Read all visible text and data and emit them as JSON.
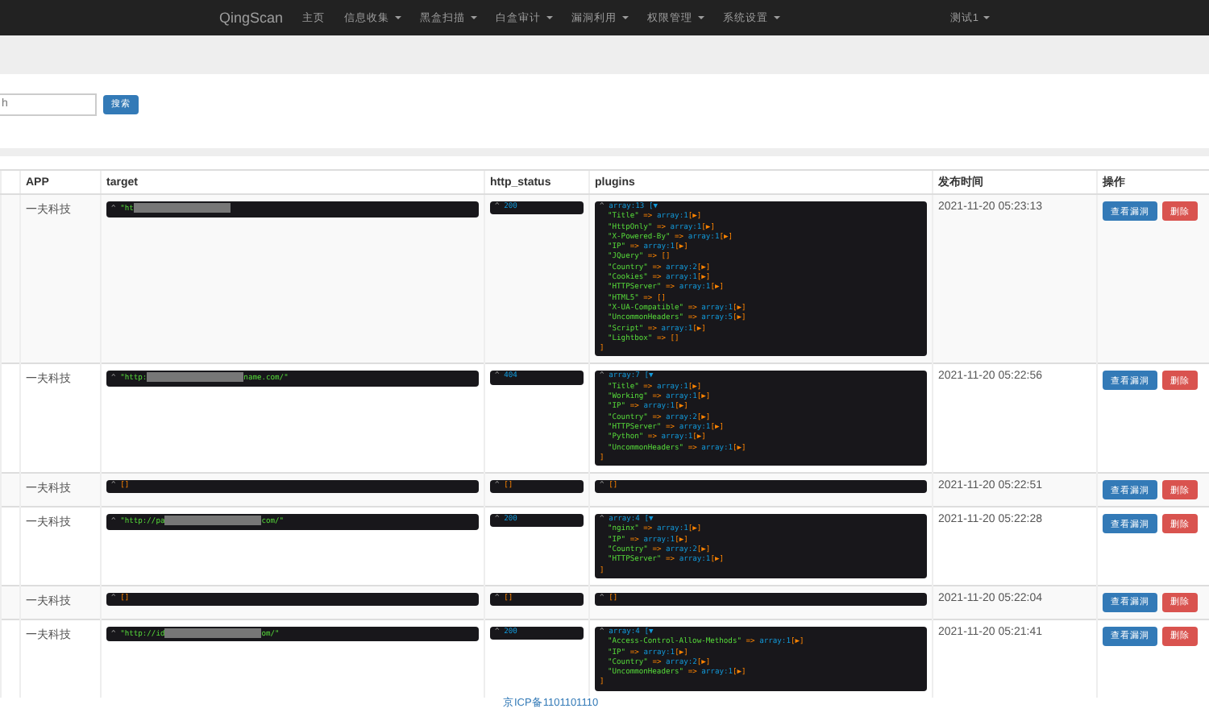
{
  "navbar": {
    "brand": "QingScan",
    "items": [
      {
        "label": "主页",
        "dropdown": false
      },
      {
        "label": "信息收集",
        "dropdown": true
      },
      {
        "label": "黑盒扫描",
        "dropdown": true
      },
      {
        "label": "白盒审计",
        "dropdown": true
      },
      {
        "label": "漏洞利用",
        "dropdown": true
      },
      {
        "label": "权限管理",
        "dropdown": true
      },
      {
        "label": "系统设置",
        "dropdown": true
      }
    ],
    "user": {
      "label": "测试1",
      "dropdown": true
    }
  },
  "search": {
    "placeholder": "h",
    "button": "搜索"
  },
  "table": {
    "columns": [
      "APP",
      "target",
      "http_status",
      "plugins",
      "发布时间",
      "操作"
    ],
    "rows": [
      {
        "app": "一夫科技",
        "target": {
          "caret": "^",
          "before": "\"ht",
          "kind": "string"
        },
        "status": {
          "caret": "^",
          "text": "200",
          "kind": "number"
        },
        "plugins": {
          "caret": "^",
          "header": "array:13 [▼",
          "close": "]",
          "entries": [
            {
              "key": "\"Title\"",
              "arrow": "=>",
              "value": "array:1",
              "toggle": "[▶]"
            },
            {
              "key": "\"HttpOnly\"",
              "arrow": "=>",
              "value": "array:1",
              "toggle": "[▶]"
            },
            {
              "key": "\"X-Powered-By\"",
              "arrow": "=>",
              "value": "array:1",
              "toggle": "[▶]"
            },
            {
              "key": "\"IP\"",
              "arrow": "=>",
              "value": "array:1",
              "toggle": "[▶]"
            },
            {
              "key": "\"JQuery\"",
              "arrow": "=>",
              "toggle": "[]"
            },
            {
              "key": "\"Country\"",
              "arrow": "=>",
              "value": "array:2",
              "toggle": "[▶]"
            },
            {
              "key": "\"Cookies\"",
              "arrow": "=>",
              "value": "array:1",
              "toggle": "[▶]"
            },
            {
              "key": "\"HTTPServer\"",
              "arrow": "=>",
              "value": "array:1",
              "toggle": "[▶]"
            },
            {
              "key": "\"HTML5\"",
              "arrow": "=>",
              "toggle": "[]"
            },
            {
              "key": "\"X-UA-Compatible\"",
              "arrow": "=>",
              "value": "array:1",
              "toggle": "[▶]"
            },
            {
              "key": "\"UncommonHeaders\"",
              "arrow": "=>",
              "value": "array:5",
              "toggle": "[▶]"
            },
            {
              "key": "\"Script\"",
              "arrow": "=>",
              "value": "array:1",
              "toggle": "[▶]"
            },
            {
              "key": "\"Lightbox\"",
              "arrow": "=>",
              "toggle": "[]"
            }
          ]
        },
        "time": "2021-11-20 05:23:13",
        "actions": [
          "查看漏洞",
          "删除"
        ]
      },
      {
        "app": "一夫科技",
        "target": {
          "caret": "^",
          "before": "\"http:",
          "after": "name.com/\"",
          "kind": "string"
        },
        "status": {
          "caret": "^",
          "text": "404",
          "kind": "number"
        },
        "plugins": {
          "caret": "^",
          "header": "array:7 [▼",
          "close": "]",
          "entries": [
            {
              "key": "\"Title\"",
              "arrow": "=>",
              "value": "array:1",
              "toggle": "[▶]"
            },
            {
              "key": "\"Working\"",
              "arrow": "=>",
              "value": "array:1",
              "toggle": "[▶]"
            },
            {
              "key": "\"IP\"",
              "arrow": "=>",
              "value": "array:1",
              "toggle": "[▶]"
            },
            {
              "key": "\"Country\"",
              "arrow": "=>",
              "value": "array:2",
              "toggle": "[▶]"
            },
            {
              "key": "\"HTTPServer\"",
              "arrow": "=>",
              "value": "array:1",
              "toggle": "[▶]"
            },
            {
              "key": "\"Python\"",
              "arrow": "=>",
              "value": "array:1",
              "toggle": "[▶]"
            },
            {
              "key": "\"UncommonHeaders\"",
              "arrow": "=>",
              "value": "array:1",
              "toggle": "[▶]"
            }
          ]
        },
        "time": "2021-11-20 05:22:56",
        "actions": [
          "查看漏洞",
          "删除"
        ]
      },
      {
        "app": "一夫科技",
        "target": {
          "caret": "^",
          "before": "[]",
          "kind": "empty"
        },
        "status": {
          "caret": "^",
          "text": "[]",
          "kind": "empty"
        },
        "plugins": {
          "caret": "^",
          "header": "[]"
        },
        "time": "2021-11-20 05:22:51",
        "actions": [
          "查看漏洞",
          "删除"
        ]
      },
      {
        "app": "一夫科技",
        "target": {
          "caret": "^",
          "before": "\"http://pa",
          "after": "com/\"",
          "kind": "string"
        },
        "status": {
          "caret": "^",
          "text": "200",
          "kind": "number"
        },
        "plugins": {
          "caret": "^",
          "header": "array:4 [▼",
          "close": "]",
          "entries": [
            {
              "key": "\"nginx\"",
              "arrow": "=>",
              "value": "array:1",
              "toggle": "[▶]"
            },
            {
              "key": "\"IP\"",
              "arrow": "=>",
              "value": "array:1",
              "toggle": "[▶]"
            },
            {
              "key": "\"Country\"",
              "arrow": "=>",
              "value": "array:2",
              "toggle": "[▶]"
            },
            {
              "key": "\"HTTPServer\"",
              "arrow": "=>",
              "value": "array:1",
              "toggle": "[▶]"
            }
          ]
        },
        "time": "2021-11-20 05:22:28",
        "actions": [
          "查看漏洞",
          "删除"
        ]
      },
      {
        "app": "一夫科技",
        "target": {
          "caret": "^",
          "before": "[]",
          "kind": "empty"
        },
        "status": {
          "caret": "^",
          "text": "[]",
          "kind": "empty"
        },
        "plugins": {
          "caret": "^",
          "header": "[]"
        },
        "time": "2021-11-20 05:22:04",
        "actions": [
          "查看漏洞",
          "删除"
        ]
      },
      {
        "app": "一夫科技",
        "target": {
          "caret": "^",
          "before": "\"http://id",
          "after": "om/\"",
          "kind": "string"
        },
        "status": {
          "caret": "^",
          "text": "200",
          "kind": "number"
        },
        "plugins": {
          "caret": "^",
          "header": "array:4 [▼",
          "close": "]",
          "entries": [
            {
              "key": "\"Access-Control-Allow-Methods\"",
              "arrow": "=>",
              "value": "array:1",
              "toggle": "[▶]"
            },
            {
              "key": "\"IP\"",
              "arrow": "=>",
              "value": "array:1",
              "toggle": "[▶]"
            },
            {
              "key": "\"Country\"",
              "arrow": "=>",
              "value": "array:2",
              "toggle": "[▶]"
            },
            {
              "key": "\"UncommonHeaders\"",
              "arrow": "=>",
              "value": "array:1",
              "toggle": "[▶]"
            }
          ]
        },
        "time": "2021-11-20 05:21:41",
        "actions": [
          "查看漏洞",
          "删除"
        ]
      }
    ]
  },
  "footer": "京ICP备1101101110"
}
